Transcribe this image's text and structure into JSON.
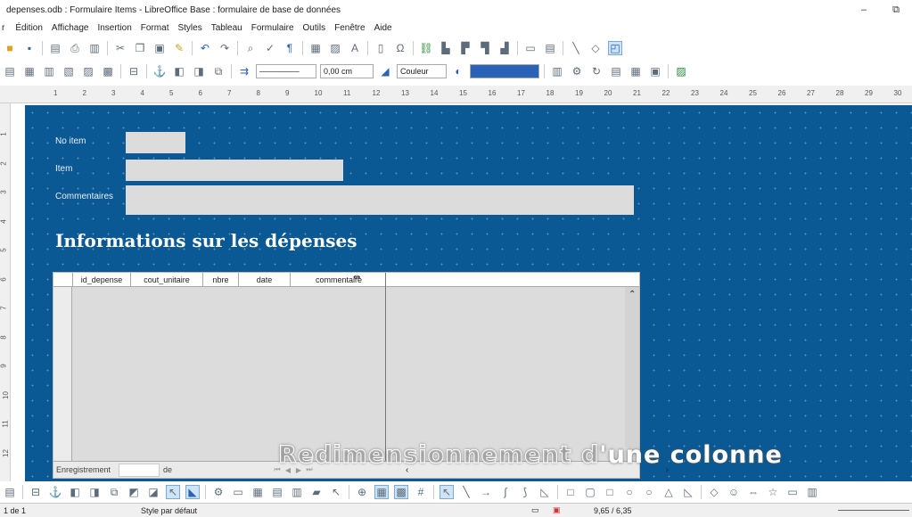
{
  "window": {
    "title": "depenses.odb : Formulaire Items - LibreOffice Base : formulaire de base de données",
    "minimize": "–",
    "restore": "⧉"
  },
  "menu": [
    "r",
    "Édition",
    "Affichage",
    "Insertion",
    "Format",
    "Styles",
    "Tableau",
    "Formulaire",
    "Outils",
    "Fenêtre",
    "Aide"
  ],
  "toolbar2": {
    "line_width": "0,00 cm",
    "fill_label": "Couleur"
  },
  "ruler": {
    "h_ticks": [
      "1",
      "2",
      "3",
      "4",
      "5",
      "6",
      "7",
      "8",
      "9",
      "10",
      "11",
      "12",
      "13",
      "14",
      "15",
      "16",
      "17",
      "18",
      "19",
      "20",
      "21",
      "22",
      "23",
      "24",
      "25",
      "26",
      "27",
      "28",
      "29",
      "30"
    ],
    "v_ticks": [
      "1",
      "2",
      "3",
      "4",
      "5",
      "6",
      "7",
      "8",
      "9",
      "10",
      "11",
      "12"
    ]
  },
  "form": {
    "labels": {
      "no_item": "No item",
      "item": "Item",
      "commentaires": "Commentaires"
    },
    "heading": "Informations sur les dépenses"
  },
  "grid": {
    "columns": [
      "id_depense",
      "cout_unitaire",
      "nbre",
      "date",
      "commentaire"
    ],
    "nav_record": "Enregistrement",
    "nav_of": "de"
  },
  "caption": {
    "outline_part": "Redimensionnement d",
    "solid_part": "'une colonne"
  },
  "status": {
    "page": "1 de 1",
    "style": "Style par défaut",
    "position": "9,65 / 6,35"
  }
}
